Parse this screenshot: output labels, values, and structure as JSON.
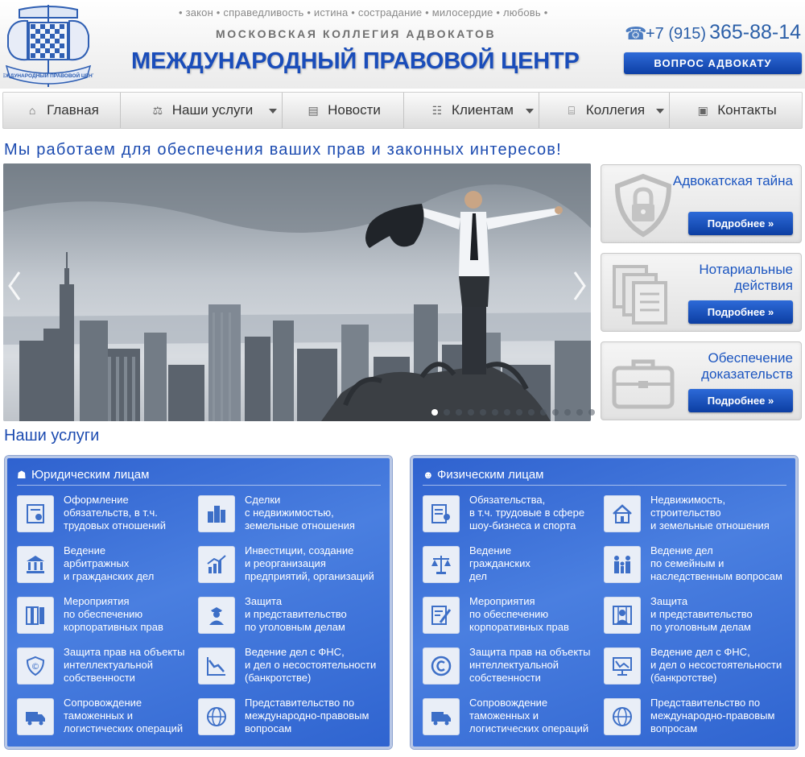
{
  "header": {
    "logo_text": "МЕЖДУНАРОДНЫЙ ПРАВОВОЙ ЦЕНТР",
    "motto": "• закон • справедливость • истина • сострадание • милосердие • любовь •",
    "college": "МОСКОВСКАЯ КОЛЛЕГИЯ АДВОКАТОВ",
    "title": "МЕЖДУНАРОДНЫЙ ПРАВОВОЙ ЦЕНТР",
    "phone_code": "+7 (915)",
    "phone_number": "365-88-14",
    "ask_button": "ВОПРОС АДВОКАТУ"
  },
  "nav": [
    {
      "label": "Главная",
      "icon": "home-icon",
      "dropdown": false
    },
    {
      "label": "Наши услуги",
      "icon": "scales-icon",
      "dropdown": true
    },
    {
      "label": "Новости",
      "icon": "document-icon",
      "dropdown": false
    },
    {
      "label": "Клиентам",
      "icon": "people-icon",
      "dropdown": true
    },
    {
      "label": "Коллегия",
      "icon": "building-icon",
      "dropdown": true
    },
    {
      "label": "Контакты",
      "icon": "contact-card-icon",
      "dropdown": false
    }
  ],
  "tagline": "Мы работаем для обеспечения ваших прав и законных интересов!",
  "slider": {
    "slide_count": 14,
    "active_index": 0
  },
  "cards": [
    {
      "title": "Адвокатская тайна",
      "button": "Подробнее »",
      "icon": "shield-lock-icon"
    },
    {
      "title": "Нотариальные действия",
      "button": "Подробнее »",
      "icon": "documents-stack-icon"
    },
    {
      "title": "Обеспечение доказательств",
      "button": "Подробнее »",
      "icon": "briefcase-icon"
    }
  ],
  "services_heading": "Наши услуги",
  "panels": [
    {
      "title": "Юридическим лицам",
      "items": [
        {
          "text": "Оформление\nобязательств, в т.ч.\nтрудовых отношений",
          "icon": "certificate-icon"
        },
        {
          "text": "Сделки\nс недвижимостью,\nземельные отношения",
          "icon": "buildings-icon"
        },
        {
          "text": "Ведение\nарбитражных\nи гражданских дел",
          "icon": "courthouse-icon"
        },
        {
          "text": "Инвестиции, создание\nи реорганизация\nпредприятий, организаций",
          "icon": "growth-chart-icon"
        },
        {
          "text": "Мероприятия\nпо обеспечению\nкорпоративных прав",
          "icon": "binders-icon"
        },
        {
          "text": "Защита\nи представительство\nпо уголовным делам",
          "icon": "policeman-icon"
        },
        {
          "text": "Защита прав на объекты\nинтеллектуальной\nсобственности",
          "icon": "copyright-shield-icon"
        },
        {
          "text": "Ведение дел с ФНС,\nи дел о несостоятельности\n(банкротстве)",
          "icon": "decline-chart-icon"
        },
        {
          "text": "Сопровождение\nтаможенных и\nлогистических операций",
          "icon": "truck-icon"
        },
        {
          "text": "Представительство по\nмеждународно-правовым\nвопросам",
          "icon": "globe-icon"
        }
      ]
    },
    {
      "title": "Физическим лицам",
      "items": [
        {
          "text": "Обязательства,\nв т.ч. трудовые в сфере\nшоу-бизнеса и спорта",
          "icon": "resume-icon"
        },
        {
          "text": "Недвижимость,\nстроительство\nи земельные отношения",
          "icon": "house-icon"
        },
        {
          "text": "Ведение\nгражданских\nдел",
          "icon": "scales-icon"
        },
        {
          "text": "Ведение дел\nпо семейным и\nнаследственным вопросам",
          "icon": "family-icon"
        },
        {
          "text": "Мероприятия\nпо обеспечению\nкорпоративных прав",
          "icon": "signed-document-icon"
        },
        {
          "text": "Защита\nи представительство\nпо уголовным делам",
          "icon": "prisoner-icon"
        },
        {
          "text": "Защита прав на объекты\nинтеллектуальной\nсобственности",
          "icon": "copyright-icon"
        },
        {
          "text": "Ведение дел с ФНС,\nи дел о несостоятельности\n(банкротстве)",
          "icon": "bankruptcy-chart-icon"
        },
        {
          "text": "Сопровождение\nтаможенных и\nлогистических операций",
          "icon": "truck-icon"
        },
        {
          "text": "Представительство по\nмеждународно-правовым\nвопросам",
          "icon": "globe-icon"
        }
      ]
    }
  ],
  "colors": {
    "brand_blue": "#1a4dba",
    "button_blue": "#0d3fa5",
    "panel_blue": "#3a6fd8"
  }
}
